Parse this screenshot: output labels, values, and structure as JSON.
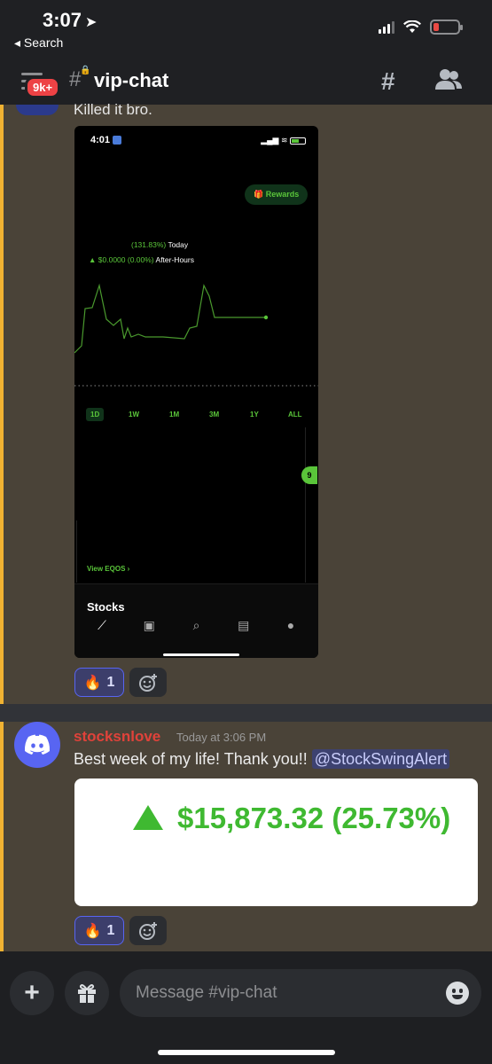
{
  "status_bar": {
    "time": "3:07",
    "back_label": "◂ Search"
  },
  "header": {
    "badge": "9k+",
    "channel_name": "vip-chat"
  },
  "message1": {
    "text": "Killed it bro.",
    "screenshot": {
      "time": "4:01",
      "rewards_label": "Rewards",
      "today_change": "(131.83%)",
      "today_label": "Today",
      "after_hours_change": "▲ $0.0000 (0.00%)",
      "after_hours_label": "After-Hours",
      "ranges": [
        "1D",
        "1W",
        "1M",
        "3M",
        "1Y",
        "ALL"
      ],
      "active_range": "1D",
      "pill_value": "9",
      "view_link": "View EQOS ›",
      "section_label": "Stocks"
    },
    "reaction": {
      "emoji": "🔥",
      "count": "1"
    }
  },
  "message2": {
    "username": "stocksnlove",
    "timestamp": "Today at 3:06 PM",
    "text": "Best week of my life! Thank you!! ",
    "mention": "@StockSwingAlert",
    "card_value": "$15,873.32 (25.73%)",
    "reaction": {
      "emoji": "🔥",
      "count": "1"
    }
  },
  "composer": {
    "placeholder": "Message #vip-chat"
  },
  "colors": {
    "accent": "#5865f2",
    "username": "#e0423a",
    "gain": "#3fb931",
    "robinhood_green": "#5ac53a",
    "highlight_bar": "#f0b232",
    "badge": "#ed4245"
  }
}
